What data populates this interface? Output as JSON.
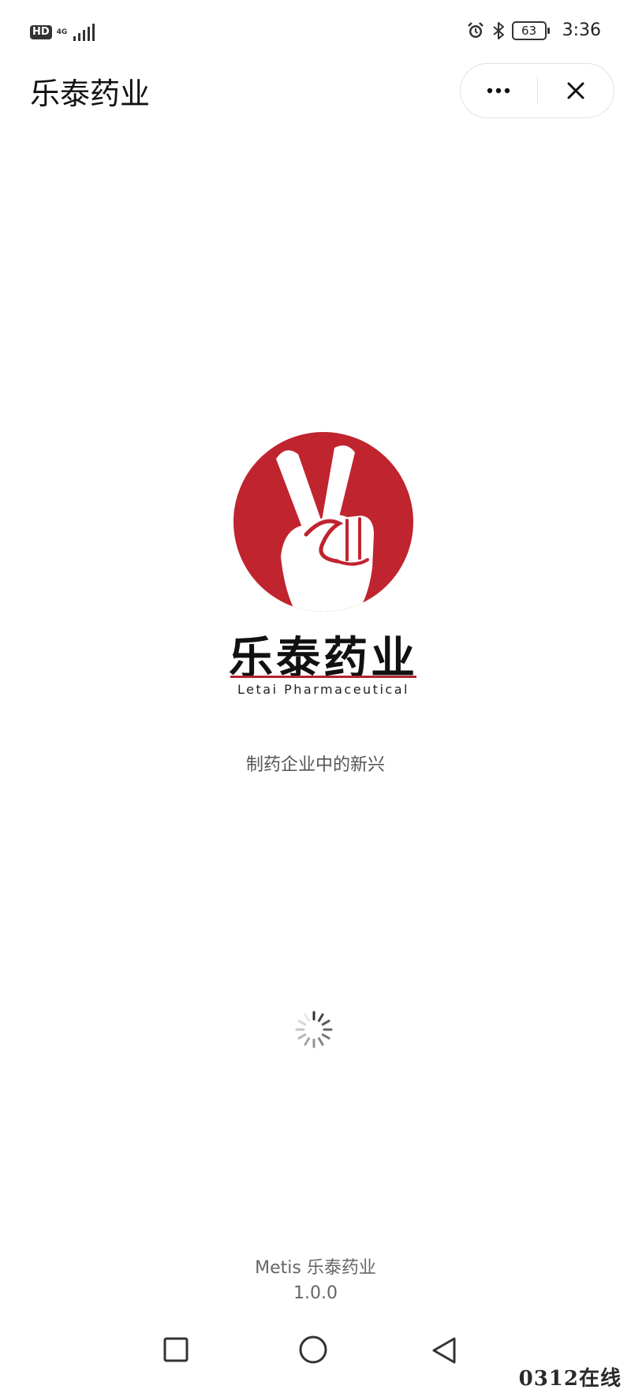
{
  "status_bar": {
    "hd_badge": "HD",
    "network_type": "4G",
    "network_sub": "46",
    "signal_icon": "signal-bars-icon",
    "alarm_icon": "alarm-clock-icon",
    "bluetooth_icon": "bluetooth-icon",
    "battery_level": "63",
    "time": "3:36"
  },
  "navbar": {
    "title": "乐泰药业",
    "more_icon": "more-dots-icon",
    "close_icon": "close-icon"
  },
  "splash": {
    "logo_icon": "peace-hand-logo-icon",
    "brand_name": "乐泰药业",
    "brand_subtitle": "Letai Pharmaceutical",
    "slogan": "制药企业中的新兴",
    "loading_icon": "loading-spinner-icon"
  },
  "footer": {
    "app_name": "Metis 乐泰药业",
    "version": "1.0.0"
  },
  "system_nav": {
    "recents_icon": "square-recents-icon",
    "home_icon": "circle-home-icon",
    "back_icon": "triangle-back-icon"
  },
  "watermark": "0312在线",
  "colors": {
    "brand_red": "#C0242F",
    "text_primary": "#111111",
    "text_secondary": "#666666",
    "background": "#FFFFFF"
  }
}
